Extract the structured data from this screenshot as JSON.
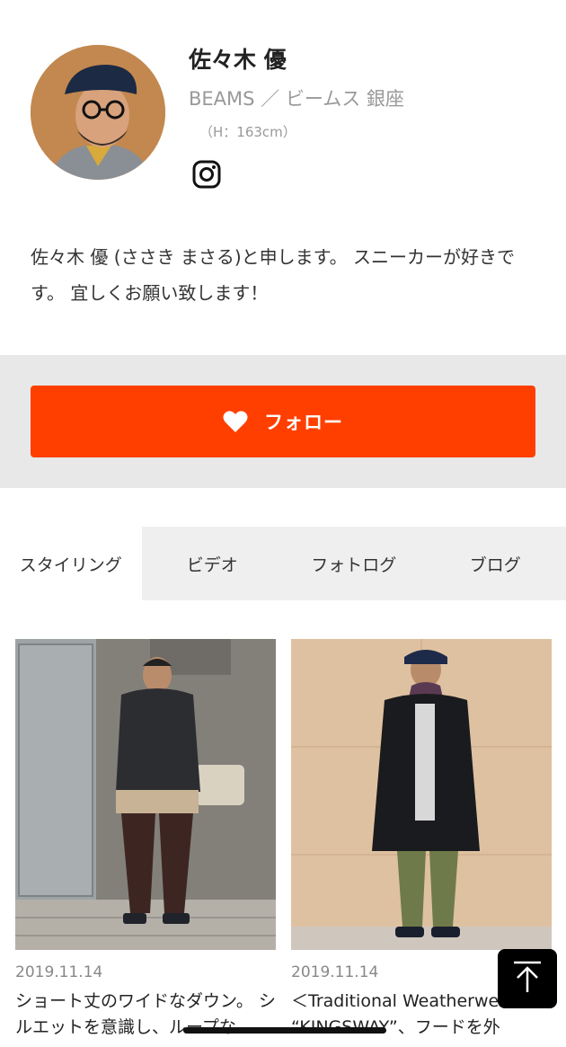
{
  "profile": {
    "name": "佐々木 優",
    "shop": "BEAMS ／ ビームス 銀座",
    "height": "（H：163cm）",
    "instagram_icon": "instagram-icon",
    "bio": "佐々木 優 (ささき まさる)と申します。 スニーカーが好きです。 宜しくお願い致します！"
  },
  "follow": {
    "label": "フォロー",
    "icon": "heart-icon",
    "color": "#ff3f00"
  },
  "tabs": [
    {
      "label": "スタイリング",
      "active": true
    },
    {
      "label": "ビデオ",
      "active": false
    },
    {
      "label": "フォトログ",
      "active": false
    },
    {
      "label": "ブログ",
      "active": false
    }
  ],
  "posts": [
    {
      "date": "2019.11.14",
      "caption": "ショート丈のワイドなダウン。 シルエットを意識し、ループな"
    },
    {
      "date": "2019.11.14",
      "caption": "＜Traditional Weatherwear＞ “KINGSWAY”、フードを外"
    }
  ],
  "scroll_top": {
    "icon": "arrow-up-icon"
  }
}
